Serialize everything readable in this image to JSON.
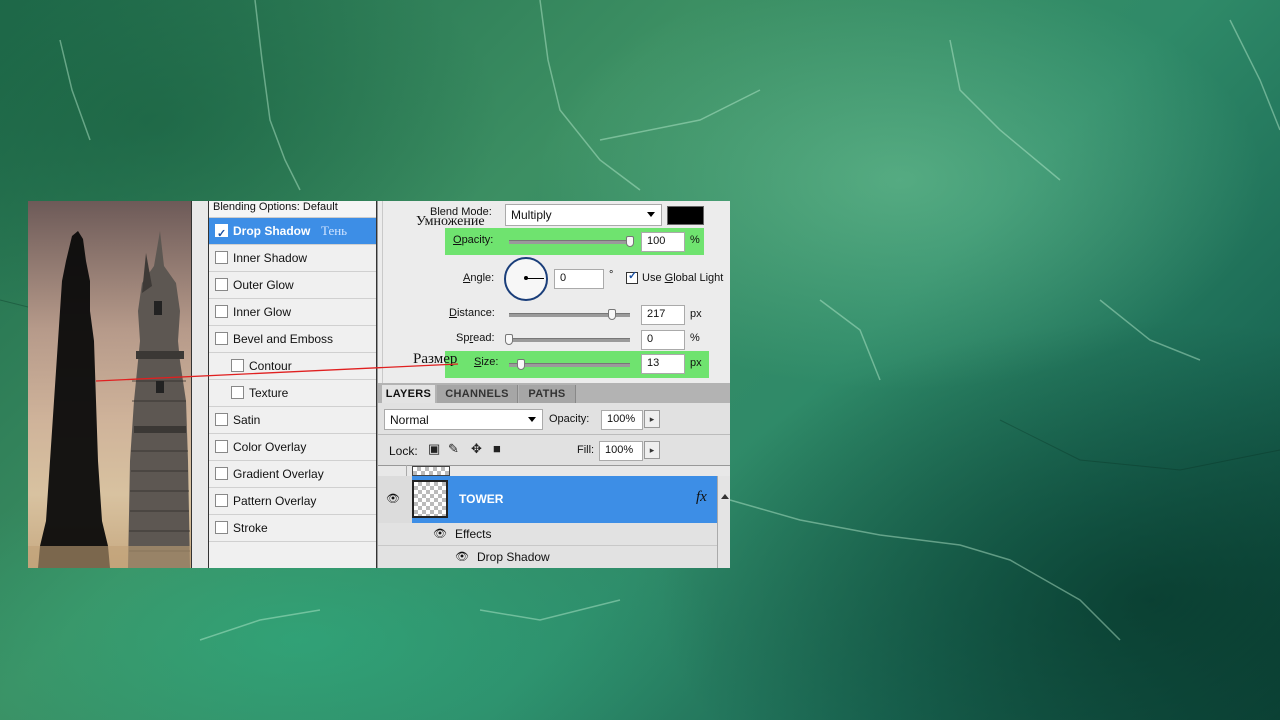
{
  "styles": {
    "header": "Blending Options: Default",
    "items": [
      {
        "label": "Drop Shadow",
        "checked": true,
        "active": true,
        "sub": false
      },
      {
        "label": "Inner Shadow",
        "checked": false,
        "active": false,
        "sub": false
      },
      {
        "label": "Outer Glow",
        "checked": false,
        "active": false,
        "sub": false
      },
      {
        "label": "Inner Glow",
        "checked": false,
        "active": false,
        "sub": false
      },
      {
        "label": "Bevel and Emboss",
        "checked": false,
        "active": false,
        "sub": false
      },
      {
        "label": "Contour",
        "checked": false,
        "active": false,
        "sub": true
      },
      {
        "label": "Texture",
        "checked": false,
        "active": false,
        "sub": true
      },
      {
        "label": "Satin",
        "checked": false,
        "active": false,
        "sub": false
      },
      {
        "label": "Color Overlay",
        "checked": false,
        "active": false,
        "sub": false
      },
      {
        "label": "Gradient Overlay",
        "checked": false,
        "active": false,
        "sub": false
      },
      {
        "label": "Pattern Overlay",
        "checked": false,
        "active": false,
        "sub": false
      },
      {
        "label": "Stroke",
        "checked": false,
        "active": false,
        "sub": false
      }
    ],
    "ru_shadow": "Тень"
  },
  "settings": {
    "blend_mode_label": "Blend Mode:",
    "blend_mode_value": "Multiply",
    "ru_multiply": "Умножение",
    "shadow_color": "#000000",
    "opacity_label": "Opacity:",
    "opacity_value": "100",
    "opacity_unit": "%",
    "opacity_level": 1.0,
    "angle_label": "Angle:",
    "angle_value": "0",
    "angle_unit": "°",
    "global_light_label": "Use Global Light",
    "global_light_checked": true,
    "distance_label": "Distance:",
    "distance_value": "217",
    "distance_unit": "px",
    "distance_level": 0.85,
    "spread_label": "Spread:",
    "spread_value": "0",
    "spread_unit": "%",
    "spread_level": 0.0,
    "size_label": "Size:",
    "size_value": "13",
    "size_unit": "px",
    "size_level": 0.1,
    "ru_size": "Размер"
  },
  "layers": {
    "tabs": [
      "LAYERS",
      "CHANNELS",
      "PATHS"
    ],
    "blend_value": "Normal",
    "opacity_label": "Opacity:",
    "opacity_value": "100%",
    "lock_label": "Lock:",
    "fill_label": "Fill:",
    "fill_value": "100%",
    "layer_name": "TOWER",
    "fx_label": "fx",
    "effects_label": "Effects",
    "effect_item": "Drop Shadow"
  },
  "colors": {
    "selection": "#3d8ee6",
    "highlight_green": "#6fe36f"
  }
}
